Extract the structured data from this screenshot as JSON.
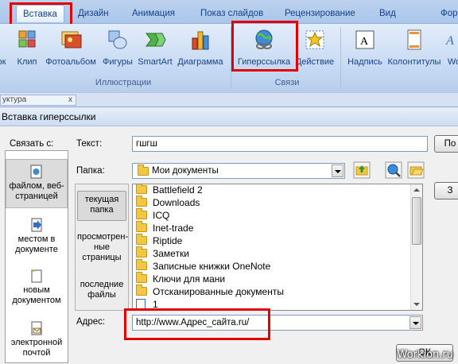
{
  "ribbon": {
    "tabs": [
      {
        "label": "Вставка",
        "active": true
      },
      {
        "label": "Дизайн"
      },
      {
        "label": "Анимация"
      },
      {
        "label": "Показ слайдов"
      },
      {
        "label": "Рецензирование"
      },
      {
        "label": "Вид"
      },
      {
        "label": "Фор"
      }
    ],
    "buttons": {
      "table": "ок",
      "clip": "Клип",
      "photoalbum": "Фотоальбом",
      "shapes": "Фигуры",
      "smartart": "SmartArt",
      "chart": "Диаграмма",
      "hyperlink": "Гиперссылка",
      "action": "Действие",
      "textbox": "Надпись",
      "headerfooter": "Колонтитулы",
      "wordart": "Wo"
    },
    "groups": {
      "illustrations": "Иллюстрации",
      "links": "Связи"
    }
  },
  "pane_tab": "уктура",
  "pane_close": "x",
  "dialog": {
    "title": "Вставка гиперссылки",
    "link_to_label": "Связать с:",
    "text_label": "Текст:",
    "text_value": "гшгш",
    "hint_button": "По",
    "folder_label": "Папка:",
    "folder_value": "Мои документы",
    "link_to_items": [
      {
        "label": "файлом, веб-страницей",
        "selected": true
      },
      {
        "label": "местом в документе"
      },
      {
        "label": "новым документом"
      },
      {
        "label": "электронной почтой"
      }
    ],
    "browse_items": [
      {
        "label": "текущая папка",
        "selected": true
      },
      {
        "label": "просмотрен-ные страницы"
      },
      {
        "label": "последние файлы"
      }
    ],
    "files": [
      {
        "name": "Battlefield 2",
        "type": "folder"
      },
      {
        "name": "Downloads",
        "type": "folder"
      },
      {
        "name": "ICQ",
        "type": "folder"
      },
      {
        "name": "Inet-trade",
        "type": "folder"
      },
      {
        "name": "Riptide",
        "type": "folder"
      },
      {
        "name": "Заметки",
        "type": "folder"
      },
      {
        "name": "Записные книжки OneNote",
        "type": "folder"
      },
      {
        "name": "Ключи для мани",
        "type": "folder"
      },
      {
        "name": "Отсканированные документы",
        "type": "folder"
      },
      {
        "name": "1",
        "type": "doc"
      }
    ],
    "address_label": "Адрес:",
    "address_value": "http://www.Адрес_сайта.ru/",
    "side_button": "З",
    "ok_button": "ОК"
  },
  "watermark": "Workion.ru",
  "colors": {
    "highlight": "#e10000",
    "ribbon_text": "#15428b"
  }
}
